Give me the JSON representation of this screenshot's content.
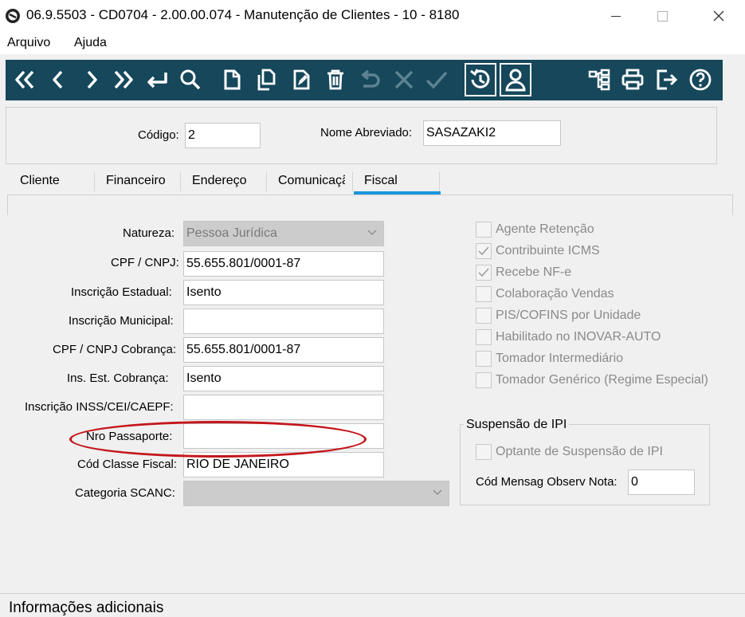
{
  "window": {
    "title": "06.9.5503 - CD0704 - 2.00.00.074 - Manutenção de Clientes - 10 - 8180",
    "minimize": "—",
    "maximize": "☐",
    "close": "✕"
  },
  "menu": {
    "arquivo": "Arquivo",
    "ajuda": "Ajuda"
  },
  "toolbar": {
    "bg_color": "#16475b",
    "icons": [
      "first-icon",
      "prev-icon",
      "next-icon",
      "last-icon",
      "return-icon",
      "search-icon",
      "new-icon",
      "copy-icon",
      "edit-icon",
      "delete-icon",
      "undo-icon",
      "cancel-icon",
      "confirm-icon",
      "history-icon",
      "user-icon",
      "tree-icon",
      "print-icon",
      "exit-icon",
      "help-icon"
    ]
  },
  "header": {
    "codigo_label": "Código:",
    "codigo_value": "2",
    "nome_label": "Nome Abreviado:",
    "nome_value": "SASAZAKI2"
  },
  "tabs": [
    "Cliente",
    "Financeiro",
    "Endereço",
    "Comunicaçã",
    "Fiscal"
  ],
  "active_tab": "Fiscal",
  "form": {
    "natureza": {
      "label": "Natureza:",
      "value": "Pessoa Jurídica"
    },
    "cpf_cnpj": {
      "label": "CPF / CNPJ:",
      "value": "55.655.801/0001-87"
    },
    "inscr_estadual": {
      "label": "Inscrição Estadual:",
      "value": "Isento"
    },
    "inscr_municipal": {
      "label": "Inscrição Municipal:",
      "value": ""
    },
    "cpf_cnpj_cobranca": {
      "label": "CPF / CNPJ Cobrança:",
      "value": "55.655.801/0001-87"
    },
    "ins_est_cobranca": {
      "label": "Ins. Est. Cobrança:",
      "value": "Isento"
    },
    "inss": {
      "label": "Inscrição INSS/CEI/CAEPF:",
      "value": ""
    },
    "passaporte": {
      "label": "Nro Passaporte:",
      "value": ""
    },
    "classe_fiscal": {
      "label": "Cód Classe Fiscal:",
      "value": "RIO DE JANEIRO"
    },
    "scanc": {
      "label": "Categoria SCANC:",
      "value": ""
    }
  },
  "checkboxes": [
    {
      "label": "Agente Retenção",
      "checked": false
    },
    {
      "label": "Contribuinte ICMS",
      "checked": true
    },
    {
      "label": "Recebe NF-e",
      "checked": true
    },
    {
      "label": "Colaboração Vendas",
      "checked": false
    },
    {
      "label": "PIS/COFINS por Unidade",
      "checked": false
    },
    {
      "label": "Habilitado no INOVAR-AUTO",
      "checked": false
    },
    {
      "label": "Tomador Intermediário",
      "checked": false
    },
    {
      "label": "Tomador Genérico (Regime Especial)",
      "checked": false
    }
  ],
  "ipi": {
    "title": "Suspensão de IPI",
    "optante_label": "Optante de Suspensão de IPI",
    "mensag_label": "Cód Mensag Observ Nota:",
    "mensag_value": "0"
  },
  "footer": {
    "text": "Informações adicionais"
  },
  "colors": {
    "accent": "#1c96dc",
    "highlight_oval": "#c4161c"
  }
}
